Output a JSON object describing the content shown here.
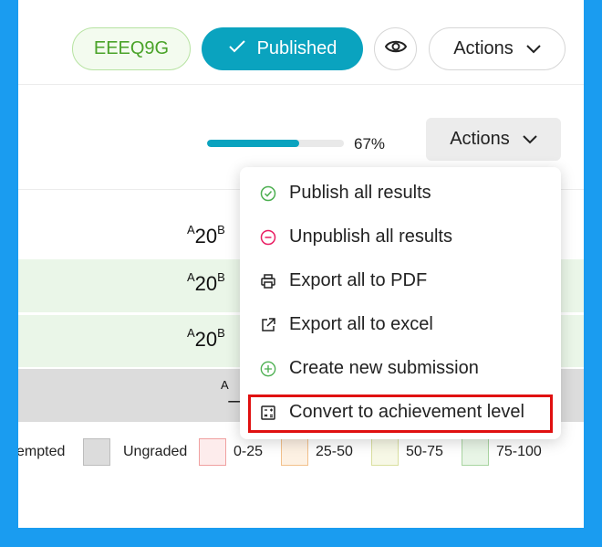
{
  "header": {
    "code": "EEEQ9G",
    "published_label": "Published",
    "actions_label": "Actions"
  },
  "progress": {
    "value": 0.67,
    "label": "67%"
  },
  "toolbar": {
    "actions_label": "Actions"
  },
  "table": {
    "rows": [
      {
        "prefix": "A",
        "score": "20",
        "suffix": "B"
      },
      {
        "prefix": "A",
        "score": "20",
        "suffix": "B"
      },
      {
        "prefix": "A",
        "score": "20",
        "suffix": "B"
      },
      {
        "prefix": "A",
        "score": "_",
        "suffix": ""
      }
    ]
  },
  "legend": [
    {
      "label": "empted",
      "fill": "",
      "border": ""
    },
    {
      "label": "Ungraded",
      "fill": "#dcdcdc",
      "border": "#bdbdbd"
    },
    {
      "label": "0-25",
      "fill": "#fdecec",
      "border": "#f0a0a0"
    },
    {
      "label": "25-50",
      "fill": "#fdf1e3",
      "border": "#f2c08a"
    },
    {
      "label": "50-75",
      "fill": "#f7f8e6",
      "border": "#d9df9e"
    },
    {
      "label": "75-100",
      "fill": "#e8f5e6",
      "border": "#a8d4a0"
    }
  ],
  "menu": {
    "items": [
      {
        "label": "Publish all results",
        "icon": "check-circle-icon"
      },
      {
        "label": "Unpublish all results",
        "icon": "minus-circle-icon"
      },
      {
        "label": "Export all to PDF",
        "icon": "printer-icon"
      },
      {
        "label": "Export all to excel",
        "icon": "external-link-icon"
      },
      {
        "label": "Create new submission",
        "icon": "plus-circle-icon"
      },
      {
        "label": "Convert to achievement level",
        "icon": "calculator-icon"
      }
    ]
  },
  "colors": {
    "accent": "#0aa3bf",
    "highlight_border": "#e01010",
    "screen_border": "#1a9cf0"
  }
}
